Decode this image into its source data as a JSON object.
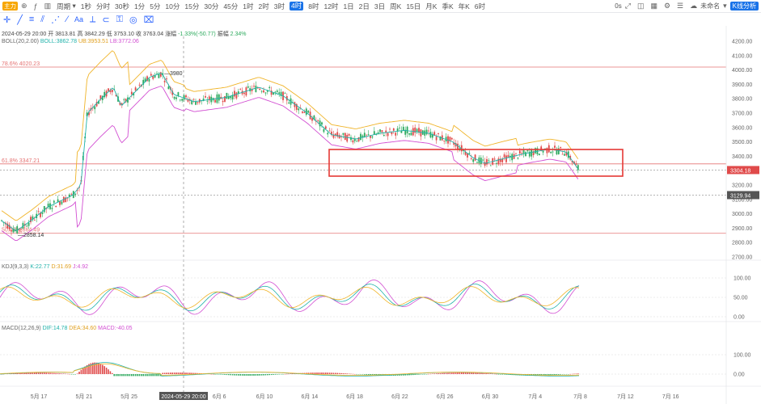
{
  "toolbar": {
    "market_tag": "主力",
    "period_label": "周期",
    "periods": [
      "1秒",
      "分时",
      "30秒",
      "1分",
      "5分",
      "10分",
      "15分",
      "30分",
      "45分",
      "1时",
      "2时",
      "3时",
      "4时",
      "8时",
      "12时",
      "1日",
      "2日",
      "3日",
      "周K",
      "15日",
      "月K",
      "季K",
      "年K",
      "6时"
    ],
    "selected_period": "4时",
    "right_items": {
      "seconds": "0s",
      "layout_name": "未命名",
      "kline_button": "K线分析"
    }
  },
  "info": {
    "datetime": "2024-05-29 20:00",
    "open_label": "开",
    "open": "3813.81",
    "high_label": "高",
    "high": "3842.29",
    "low_label": "低",
    "low": "3753.10",
    "close_label": "收",
    "close": "3763.04",
    "change_label": "涨幅",
    "change": "-1.33%(-50.77)",
    "amp_label": "振幅",
    "amp": "2.34%"
  },
  "boll": {
    "name": "BOLL(20,2.00)",
    "mid": "BOLL:3862.78",
    "up": "UB:3953.51",
    "lb": "LB:3772.06"
  },
  "kdj": {
    "name": "KDJ(9,3,3)",
    "k": "K:22.77",
    "d": "D:31.69",
    "j": "J:4.92"
  },
  "macd": {
    "name": "MACD(12,26,9)",
    "dif": "DIF:14.78",
    "dea": "DEA:34.60",
    "macd": "MACD:-40.05"
  },
  "levels": {
    "fib786": "78.6% 4020.23",
    "fib618": "61.8% 3347.21",
    "fib50": "50.0% 2864.49",
    "high_mark": "3980",
    "low_mark": "2858.14"
  },
  "price_axis": [
    "4200.00",
    "4100.00",
    "4000.00",
    "3900.00",
    "3800.00",
    "3700.00",
    "3600.00",
    "3500.00",
    "3400.00",
    "3300.00",
    "3200.00",
    "3100.00",
    "3000.00",
    "2900.00",
    "2800.00",
    "2700.00"
  ],
  "price_badges": {
    "last": "3304.18",
    "cursor": "3129.94"
  },
  "kdj_axis": [
    "100.00",
    "50.00",
    "0.00"
  ],
  "macd_axis": [
    "100.00",
    "0.00"
  ],
  "time_axis": [
    "5月 17",
    "5月 21",
    "5月 25",
    "6月 2",
    "6月 6",
    "6月 10",
    "6月 14",
    "6月 18",
    "6月 22",
    "6月 26",
    "6月 30",
    "7月 4",
    "7月 8",
    "7月 12",
    "7月 16"
  ],
  "crosshair_time": "2024-05-29 20:00",
  "colors": {
    "up": "#2eaa5e",
    "down": "#e04a4a",
    "boll_up": "#f0b429",
    "boll_mid": "#20b2aa",
    "boll_lb": "#d24fd2",
    "fib": "#e57373",
    "box": "#e53935"
  }
}
